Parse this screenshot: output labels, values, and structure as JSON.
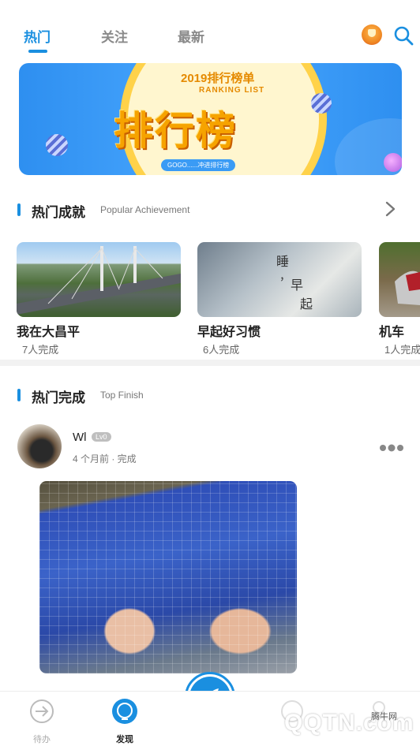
{
  "topbar": {
    "tabs": [
      "热门",
      "关注",
      "最新"
    ],
    "active_tab": "热门",
    "icons": [
      "trophy-icon",
      "search-icon"
    ]
  },
  "banner": {
    "year_title": "2019排行榜单",
    "subtitle": "RANKING LIST",
    "main_text": "排行榜",
    "footer_text": "GOGO......冲进排行榜"
  },
  "achievements": {
    "title": "热门成就",
    "subtitle": "Popular Achievement",
    "cards": [
      {
        "title": "我在大昌平",
        "count": "7人完成"
      },
      {
        "title": "早起好习惯",
        "count": "6人完成"
      },
      {
        "title": "机车",
        "count": "1人完成"
      }
    ]
  },
  "finish": {
    "title": "热门完成",
    "subtitle": "Top Finish",
    "post": {
      "user": "Wl",
      "level": "Lv0",
      "meta": "4 个月前 · 完成"
    }
  },
  "bottom_nav": {
    "items": [
      {
        "label": "待办",
        "icon": "todo-arrow-icon"
      },
      {
        "label": "发现",
        "icon": "discover-bubble-icon"
      }
    ],
    "fab_icon": "feather-pen-icon"
  },
  "watermark": {
    "text": "QQTN.com",
    "small": "腾牛网"
  },
  "colors": {
    "accent": "#1a8fe0",
    "muted": "#8a8a8a"
  }
}
